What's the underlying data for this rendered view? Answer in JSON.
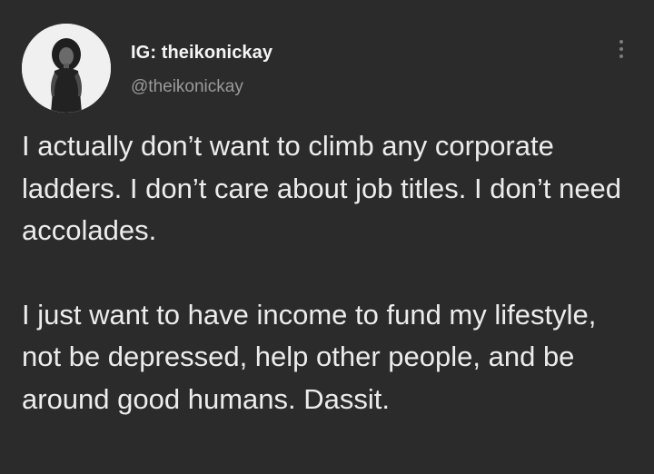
{
  "author": {
    "display_name": "IG: theikonickay",
    "handle": "@theikonickay",
    "avatar_icon": "profile-photo"
  },
  "header": {
    "more_icon": "vertical-ellipsis-icon"
  },
  "tweet": {
    "paragraph_1": "I actually don’t want to climb any corporate ladders. I don’t care about job titles. I don’t need accolades.",
    "paragraph_2": "I just want to have income to fund my lifestyle, not be depressed, help other people, and be around good humans. Dassit."
  },
  "colors": {
    "background": "#2b2b2b",
    "text": "#ececec",
    "handle": "#9a9a9a"
  }
}
